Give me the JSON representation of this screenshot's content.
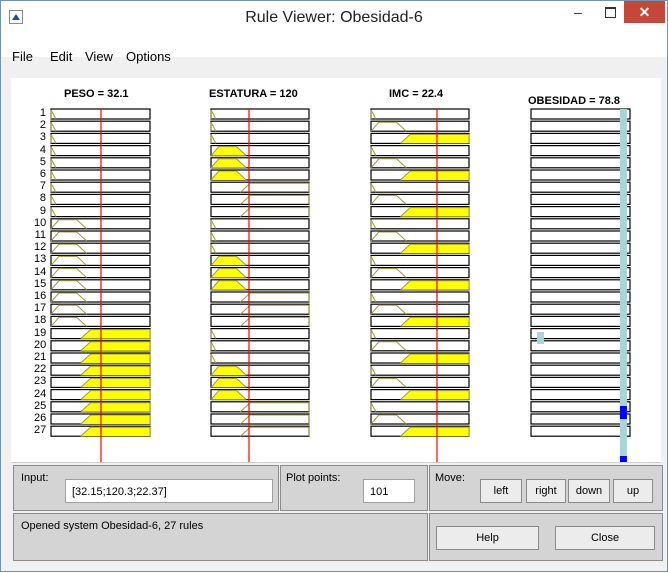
{
  "window": {
    "title": "Rule Viewer: Obesidad-6"
  },
  "menu": {
    "file": "File",
    "edit": "Edit",
    "view": "View",
    "options": "Options"
  },
  "columns": [
    {
      "label": "PESO = 32.1"
    },
    {
      "label": "ESTATURA = 120"
    },
    {
      "label": "IMC = 22.4"
    },
    {
      "label": "OBESIDAD = 78.8"
    }
  ],
  "rule_numbers": [
    "1",
    "2",
    "3",
    "4",
    "5",
    "6",
    "7",
    "8",
    "9",
    "10",
    "11",
    "12",
    "13",
    "14",
    "15",
    "16",
    "17",
    "18",
    "19",
    "20",
    "21",
    "22",
    "23",
    "24",
    "25",
    "26",
    "27"
  ],
  "rules": {
    "peso": [
      "bajo",
      "bajo",
      "bajo",
      "bajo",
      "bajo",
      "bajo",
      "bajo",
      "bajo",
      "bajo",
      "medio",
      "medio",
      "medio",
      "medio",
      "medio",
      "medio",
      "medio",
      "medio",
      "medio",
      "alto",
      "alto",
      "alto",
      "alto",
      "alto",
      "alto",
      "alto",
      "alto",
      "alto"
    ],
    "estatura": [
      "bajo",
      "bajo",
      "bajo",
      "medio",
      "medio",
      "medio",
      "alto",
      "alto",
      "alto",
      "bajo",
      "bajo",
      "bajo",
      "medio",
      "medio",
      "medio",
      "alto",
      "alto",
      "alto",
      "bajo",
      "bajo",
      "bajo",
      "medio",
      "medio",
      "medio",
      "alto",
      "alto",
      "alto"
    ],
    "imc": [
      "bajo",
      "medio",
      "alto",
      "bajo",
      "medio",
      "alto",
      "bajo",
      "medio",
      "alto",
      "bajo",
      "medio",
      "alto",
      "bajo",
      "medio",
      "alto",
      "bajo",
      "medio",
      "alto",
      "bajo",
      "medio",
      "alto",
      "bajo",
      "medio",
      "alto",
      "bajo",
      "medio",
      "alto"
    ]
  },
  "output_level": 0.788,
  "colors": {
    "fill": "#ffff00",
    "mf_line": "#a09a40",
    "input_line": "#ff0000",
    "output_bar": "#a7d6d6",
    "output_marker": "#0000ff"
  },
  "input": {
    "label": "Input:",
    "value": "[32.15;120.3;22.37]"
  },
  "plot_points": {
    "label": "Plot points:",
    "value": "101"
  },
  "move": {
    "label": "Move:",
    "left": "left",
    "right": "right",
    "down": "down",
    "up": "up"
  },
  "status": "Opened system Obesidad-6, 27 rules",
  "buttons": {
    "help": "Help",
    "close": "Close"
  }
}
